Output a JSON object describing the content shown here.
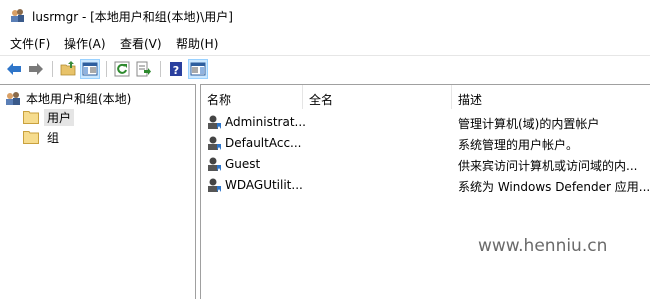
{
  "window": {
    "title": "lusrmgr - [本地用户和组(本地)\\用户]"
  },
  "menu": {
    "items": [
      "文件(F)",
      "操作(A)",
      "查看(V)",
      "帮助(H)"
    ]
  },
  "toolbar": {
    "buttons": [
      "back",
      "forward",
      "up-folder",
      "show-hide-console-tree",
      "refresh",
      "export-list",
      "help",
      "show-hide-action-pane"
    ]
  },
  "tree": {
    "root": "本地用户和组(本地)",
    "nodes": [
      {
        "label": "用户",
        "selected": true
      },
      {
        "label": "组",
        "selected": false
      }
    ]
  },
  "table": {
    "columns": [
      "名称",
      "全名",
      "描述"
    ],
    "rows": [
      {
        "name": "Administrat...",
        "full_name": "",
        "description": "管理计算机(域)的内置帐户"
      },
      {
        "name": "DefaultAcc...",
        "full_name": "",
        "description": "系统管理的用户帐户。"
      },
      {
        "name": "Guest",
        "full_name": "",
        "description": "供来宾访问计算机或访问域的内..."
      },
      {
        "name": "WDAGUtilit...",
        "full_name": "",
        "description": "系统为 Windows Defender 应用..."
      }
    ]
  },
  "watermark": "www.henniu.cn",
  "colors": {
    "selection": "#cce8ff",
    "accent": "#0078d7"
  }
}
